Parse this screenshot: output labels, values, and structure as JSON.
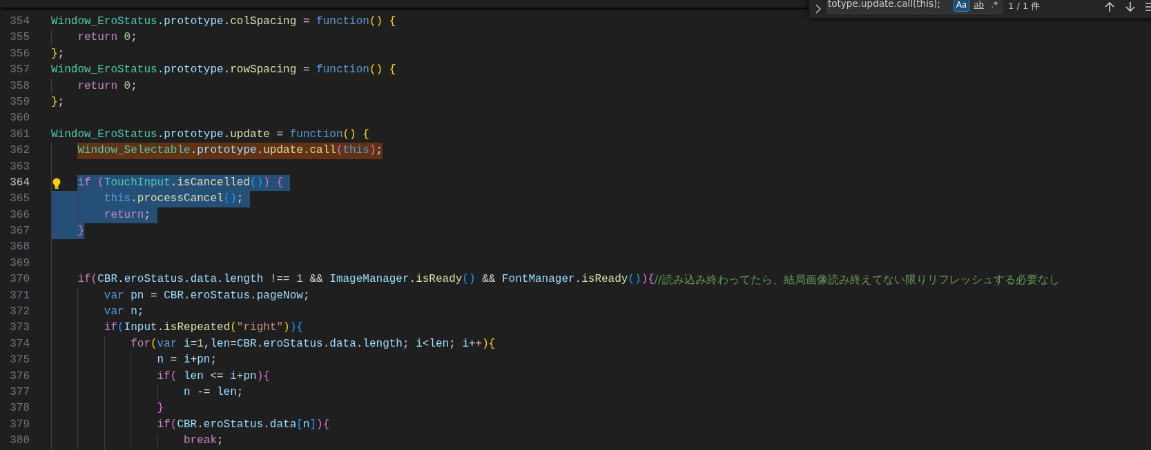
{
  "find_widget": {
    "query": "totype.update.call(this);",
    "options": [
      {
        "kind": "match-case",
        "label": "Aa",
        "selected": true
      },
      {
        "kind": "whole-word",
        "label": "ab",
        "selected": false
      },
      {
        "kind": "regex",
        "label": ".*",
        "selected": false
      }
    ],
    "result": "1 / 1 件"
  },
  "lines": [
    {
      "number": "354",
      "tokens": [
        {
          "kind": "class",
          "text": "Window_EroStatus"
        },
        {
          "kind": "plain",
          "text": "."
        },
        {
          "kind": "variable",
          "text": "prototype"
        },
        {
          "kind": "plain",
          "text": "."
        },
        {
          "kind": "function",
          "text": "colSpacing"
        },
        {
          "kind": "plain",
          "text": " = "
        },
        {
          "kind": "storage",
          "text": "function"
        },
        {
          "kind": "bracket1",
          "text": "()"
        },
        {
          "kind": "bracket1",
          "text": " {"
        }
      ]
    },
    {
      "number": "355",
      "tokens": [
        {
          "kind": "keyword",
          "text": "    return"
        },
        {
          "kind": "number",
          "text": " 0"
        },
        {
          "kind": "plain",
          "text": ";"
        }
      ]
    },
    {
      "number": "356",
      "tokens": [
        {
          "kind": "bracket1",
          "text": "}"
        },
        {
          "kind": "plain",
          "text": ";"
        }
      ]
    },
    {
      "number": "357",
      "tokens": [
        {
          "kind": "class",
          "text": "Window_EroStatus"
        },
        {
          "kind": "plain",
          "text": "."
        },
        {
          "kind": "variable",
          "text": "prototype"
        },
        {
          "kind": "plain",
          "text": "."
        },
        {
          "kind": "function",
          "text": "rowSpacing"
        },
        {
          "kind": "plain",
          "text": " = "
        },
        {
          "kind": "storage",
          "text": "function"
        },
        {
          "kind": "bracket1",
          "text": "()"
        },
        {
          "kind": "bracket1",
          "text": " {"
        }
      ]
    },
    {
      "number": "358",
      "tokens": [
        {
          "kind": "keyword",
          "text": "    return"
        },
        {
          "kind": "number",
          "text": " 0"
        },
        {
          "kind": "plain",
          "text": ";"
        }
      ]
    },
    {
      "number": "359",
      "tokens": [
        {
          "kind": "bracket1",
          "text": "}"
        },
        {
          "kind": "plain",
          "text": ";"
        }
      ]
    },
    {
      "number": "360"
    },
    {
      "number": "361",
      "tokens": [
        {
          "kind": "class",
          "text": "Window_EroStatus"
        },
        {
          "kind": "plain",
          "text": "."
        },
        {
          "kind": "variable",
          "text": "prototype"
        },
        {
          "kind": "plain",
          "text": "."
        },
        {
          "kind": "function",
          "text": "update"
        },
        {
          "kind": "plain",
          "text": " = "
        },
        {
          "kind": "storage",
          "text": "function"
        },
        {
          "kind": "bracket1",
          "text": "()"
        },
        {
          "kind": "bracket1",
          "text": " {"
        }
      ]
    },
    {
      "number": "362",
      "find_match": true,
      "tokens": [
        {
          "kind": "class",
          "text": "    Window_Selectable"
        },
        {
          "kind": "plain",
          "text": "."
        },
        {
          "kind": "variable",
          "text": "prototype"
        },
        {
          "kind": "plain",
          "text": "."
        },
        {
          "kind": "function",
          "text": "update"
        },
        {
          "kind": "plain",
          "text": "."
        },
        {
          "kind": "function",
          "text": "call"
        },
        {
          "kind": "bracket2",
          "text": "("
        },
        {
          "kind": "storage",
          "text": "this"
        },
        {
          "kind": "bracket2",
          "text": ")"
        },
        {
          "kind": "plain",
          "text": ";"
        }
      ]
    },
    {
      "number": "363"
    },
    {
      "number": "364",
      "current": true,
      "selected": true,
      "lightbulb": true,
      "tokens": [
        {
          "kind": "keyword",
          "text": "    if"
        },
        {
          "kind": "bracket2",
          "text": " ("
        },
        {
          "kind": "class",
          "text": "TouchInput"
        },
        {
          "kind": "plain",
          "text": "."
        },
        {
          "kind": "function",
          "text": "isCancelled"
        },
        {
          "kind": "bracket3",
          "text": "()"
        },
        {
          "kind": "bracket2",
          "text": ")"
        },
        {
          "kind": "bracket2",
          "text": " {"
        }
      ]
    },
    {
      "number": "365",
      "selected": true,
      "tokens": [
        {
          "kind": "storage",
          "text": "        this"
        },
        {
          "kind": "plain",
          "text": "."
        },
        {
          "kind": "function",
          "text": "processCancel"
        },
        {
          "kind": "bracket3",
          "text": "()"
        },
        {
          "kind": "plain",
          "text": ";"
        }
      ]
    },
    {
      "number": "366",
      "selected": true,
      "tokens": [
        {
          "kind": "keyword",
          "text": "        return"
        },
        {
          "kind": "plain",
          "text": ";"
        }
      ]
    },
    {
      "number": "367",
      "selected": true,
      "tokens": [
        {
          "kind": "bracket2",
          "text": "    }"
        }
      ]
    },
    {
      "number": "368"
    },
    {
      "number": "369"
    },
    {
      "number": "370",
      "tokens": [
        {
          "kind": "keyword",
          "text": "    if"
        },
        {
          "kind": "bracket2",
          "text": "("
        },
        {
          "kind": "variable",
          "text": "CBR"
        },
        {
          "kind": "plain",
          "text": "."
        },
        {
          "kind": "variable",
          "text": "eroStatus"
        },
        {
          "kind": "plain",
          "text": "."
        },
        {
          "kind": "variable",
          "text": "data"
        },
        {
          "kind": "plain",
          "text": "."
        },
        {
          "kind": "variable",
          "text": "length"
        },
        {
          "kind": "plain",
          "text": " !== "
        },
        {
          "kind": "number",
          "text": "1"
        },
        {
          "kind": "plain",
          "text": " && "
        },
        {
          "kind": "variable",
          "text": "ImageManager"
        },
        {
          "kind": "plain",
          "text": "."
        },
        {
          "kind": "function",
          "text": "isReady"
        },
        {
          "kind": "bracket3",
          "text": "()"
        },
        {
          "kind": "plain",
          "text": " && "
        },
        {
          "kind": "variable",
          "text": "FontManager"
        },
        {
          "kind": "plain",
          "text": "."
        },
        {
          "kind": "function",
          "text": "isReady"
        },
        {
          "kind": "bracket3",
          "text": "()"
        },
        {
          "kind": "bracket2",
          "text": ")"
        },
        {
          "kind": "bracket2",
          "text": "{"
        },
        {
          "kind": "comment",
          "text": "//読み込み終わってたら、結局画像読み終えてない限りリフレッシュする必要なし"
        }
      ]
    },
    {
      "number": "371",
      "tokens": [
        {
          "kind": "storage",
          "text": "        var"
        },
        {
          "kind": "variable",
          "text": " pn"
        },
        {
          "kind": "plain",
          "text": " = "
        },
        {
          "kind": "variable",
          "text": "CBR"
        },
        {
          "kind": "plain",
          "text": "."
        },
        {
          "kind": "variable",
          "text": "eroStatus"
        },
        {
          "kind": "plain",
          "text": "."
        },
        {
          "kind": "variable",
          "text": "pageNow"
        },
        {
          "kind": "plain",
          "text": ";"
        }
      ]
    },
    {
      "number": "372",
      "tokens": [
        {
          "kind": "storage",
          "text": "        var"
        },
        {
          "kind": "variable",
          "text": " n"
        },
        {
          "kind": "plain",
          "text": ";"
        }
      ]
    },
    {
      "number": "373",
      "tokens": [
        {
          "kind": "keyword",
          "text": "        if"
        },
        {
          "kind": "bracket3",
          "text": "("
        },
        {
          "kind": "variable",
          "text": "Input"
        },
        {
          "kind": "plain",
          "text": "."
        },
        {
          "kind": "function",
          "text": "isRepeated"
        },
        {
          "kind": "bracket1",
          "text": "("
        },
        {
          "kind": "string",
          "text": "\"right\""
        },
        {
          "kind": "bracket1",
          "text": ")"
        },
        {
          "kind": "bracket3",
          "text": ")"
        },
        {
          "kind": "bracket3",
          "text": "{"
        }
      ]
    },
    {
      "number": "374",
      "tokens": [
        {
          "kind": "keyword",
          "text": "            for"
        },
        {
          "kind": "bracket1",
          "text": "("
        },
        {
          "kind": "storage",
          "text": "var"
        },
        {
          "kind": "variable",
          "text": " i"
        },
        {
          "kind": "plain",
          "text": "="
        },
        {
          "kind": "number",
          "text": "1"
        },
        {
          "kind": "plain",
          "text": ","
        },
        {
          "kind": "variable",
          "text": "len"
        },
        {
          "kind": "plain",
          "text": "="
        },
        {
          "kind": "variable",
          "text": "CBR"
        },
        {
          "kind": "plain",
          "text": "."
        },
        {
          "kind": "variable",
          "text": "eroStatus"
        },
        {
          "kind": "plain",
          "text": "."
        },
        {
          "kind": "variable",
          "text": "data"
        },
        {
          "kind": "plain",
          "text": "."
        },
        {
          "kind": "variable",
          "text": "length"
        },
        {
          "kind": "plain",
          "text": ";"
        },
        {
          "kind": "variable",
          "text": " i"
        },
        {
          "kind": "plain",
          "text": "<"
        },
        {
          "kind": "variable",
          "text": "len"
        },
        {
          "kind": "plain",
          "text": ";"
        },
        {
          "kind": "variable",
          "text": " i"
        },
        {
          "kind": "plain",
          "text": "++"
        },
        {
          "kind": "bracket1",
          "text": ")"
        },
        {
          "kind": "bracket1",
          "text": "{"
        }
      ]
    },
    {
      "number": "375",
      "tokens": [
        {
          "kind": "variable",
          "text": "                n"
        },
        {
          "kind": "plain",
          "text": " = "
        },
        {
          "kind": "variable",
          "text": "i"
        },
        {
          "kind": "plain",
          "text": "+"
        },
        {
          "kind": "variable",
          "text": "pn"
        },
        {
          "kind": "plain",
          "text": ";"
        }
      ]
    },
    {
      "number": "376",
      "tokens": [
        {
          "kind": "keyword",
          "text": "                if"
        },
        {
          "kind": "bracket2",
          "text": "("
        },
        {
          "kind": "variable",
          "text": " len"
        },
        {
          "kind": "plain",
          "text": " <= "
        },
        {
          "kind": "variable",
          "text": "i"
        },
        {
          "kind": "plain",
          "text": "+"
        },
        {
          "kind": "variable",
          "text": "pn"
        },
        {
          "kind": "bracket2",
          "text": ")"
        },
        {
          "kind": "bracket2",
          "text": "{"
        }
      ]
    },
    {
      "number": "377",
      "tokens": [
        {
          "kind": "variable",
          "text": "                    n"
        },
        {
          "kind": "plain",
          "text": " -= "
        },
        {
          "kind": "variable",
          "text": "len"
        },
        {
          "kind": "plain",
          "text": ";"
        }
      ]
    },
    {
      "number": "378",
      "tokens": [
        {
          "kind": "bracket2",
          "text": "                }"
        }
      ]
    },
    {
      "number": "379",
      "tokens": [
        {
          "kind": "keyword",
          "text": "                if"
        },
        {
          "kind": "bracket2",
          "text": "("
        },
        {
          "kind": "variable",
          "text": "CBR"
        },
        {
          "kind": "plain",
          "text": "."
        },
        {
          "kind": "variable",
          "text": "eroStatus"
        },
        {
          "kind": "plain",
          "text": "."
        },
        {
          "kind": "variable",
          "text": "data"
        },
        {
          "kind": "bracket3",
          "text": "["
        },
        {
          "kind": "variable",
          "text": "n"
        },
        {
          "kind": "bracket3",
          "text": "]"
        },
        {
          "kind": "bracket2",
          "text": ")"
        },
        {
          "kind": "bracket2",
          "text": "{"
        }
      ]
    },
    {
      "number": "380",
      "tokens": [
        {
          "kind": "keyword",
          "text": "                    break"
        },
        {
          "kind": "plain",
          "text": ";"
        }
      ]
    }
  ]
}
